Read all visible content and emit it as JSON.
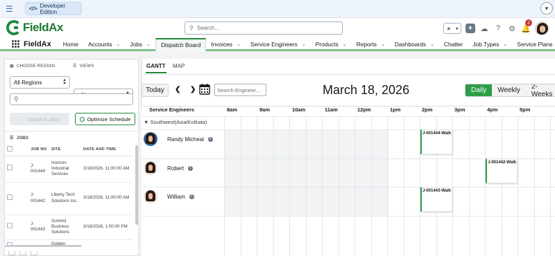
{
  "topbar": {
    "edition_label": "Developer Edition"
  },
  "header": {
    "logo_text": "FieldAx",
    "search_placeholder": "Search...",
    "notification_count": "2"
  },
  "nav": {
    "app_name": "FieldAx",
    "items": [
      {
        "label": "Home"
      },
      {
        "label": "Accounts"
      },
      {
        "label": "Jobs"
      },
      {
        "label": "Dispatch Board"
      },
      {
        "label": "Invoices"
      },
      {
        "label": "Service Engineers"
      },
      {
        "label": "Products"
      },
      {
        "label": "Reports"
      },
      {
        "label": "Dashboards"
      },
      {
        "label": "Chatter"
      },
      {
        "label": "Job Types"
      },
      {
        "label": "Service Plans"
      }
    ]
  },
  "left": {
    "choose_region_label": "CHOOSE REGION",
    "views_label": "VIEWS",
    "region_value": "All Regions",
    "views_value": "--None--",
    "dispatch_label": "Dispatch Jobs",
    "optimize_label": "Optimize Schedule",
    "jobs_label": "JOBS",
    "columns": [
      "JOB NO",
      "SITE",
      "DATE AND TIME"
    ],
    "rows": [
      {
        "job": "J-001444",
        "site": "Horizon Industrial Services",
        "dt": "3/18/2026, 11:00:00 AM"
      },
      {
        "job": "J-001442",
        "site": "Liberty Tech Solutions Inc.",
        "dt": "3/18/2026, 11:00:00 AM"
      },
      {
        "job": "J-001443",
        "site": "Summit Business Solutions",
        "dt": "3/18/2026, 1:00:00 PM"
      },
      {
        "job": "",
        "site": "Golden",
        "dt": ""
      }
    ]
  },
  "right": {
    "tabs": [
      "GANTT",
      "MAP"
    ],
    "today_label": "Today",
    "engineer_search_placeholder": "Search Engineer...",
    "date_title": "March 18, 2026",
    "views": [
      "Daily",
      "Weekly",
      "2-Weeks"
    ],
    "active_view": "Daily",
    "gantt": {
      "engineers_header": "Service Engineers",
      "hours": [
        "8am",
        "9am",
        "10am",
        "11am",
        "12pm",
        "1pm",
        "2pm",
        "3pm",
        "4pm",
        "5pm"
      ],
      "region_group": "Southwest(Asia/Kolkata)",
      "engineers": [
        {
          "name": "Randy Micheal",
          "job": "J-001444-Walk"
        },
        {
          "name": "Robert",
          "job": "J-001442-Walk"
        },
        {
          "name": "William",
          "job": "J-001443-Walk"
        }
      ]
    }
  },
  "colors": {
    "brand_green": "#1f8a3a",
    "active_toggle": "#2e9d48",
    "badge_red": "#c23934"
  }
}
